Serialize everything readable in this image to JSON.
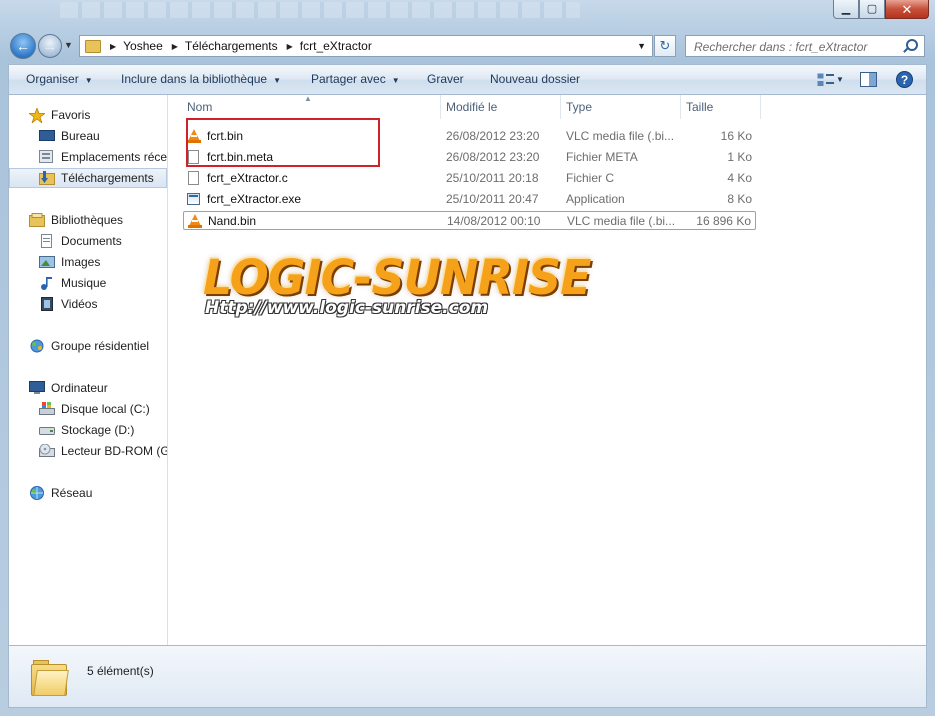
{
  "window": {
    "buttons": {
      "minimize": "▁",
      "maximize": "▢",
      "close": "✕"
    }
  },
  "address": {
    "crumbs": [
      "Yoshee",
      "Téléchargements",
      "fcrt_eXtractor"
    ],
    "search_placeholder": "Rechercher dans : fcrt_eXtractor"
  },
  "toolbar": {
    "organiser": "Organiser",
    "inclure": "Inclure dans la bibliothèque",
    "partager": "Partager avec",
    "graver": "Graver",
    "nouveau_dossier": "Nouveau dossier"
  },
  "nav": {
    "favoris": "Favoris",
    "bureau": "Bureau",
    "emplacements": "Emplacements récents",
    "telechargements": "Téléchargements",
    "bibliotheques": "Bibliothèques",
    "documents": "Documents",
    "images": "Images",
    "musique": "Musique",
    "videos": "Vidéos",
    "groupe": "Groupe résidentiel",
    "ordinateur": "Ordinateur",
    "disque_c": "Disque local (C:)",
    "stockage_d": "Stockage (D:)",
    "lecteur_bd": "Lecteur BD-ROM (G:",
    "reseau": "Réseau"
  },
  "columns": {
    "name": "Nom",
    "modified": "Modifié le",
    "type": "Type",
    "size": "Taille"
  },
  "files": [
    {
      "name": "fcrt.bin",
      "modified": "26/08/2012 23:20",
      "type": "VLC media file (.bi...",
      "size": "16 Ko",
      "icon": "vlc-icon"
    },
    {
      "name": "fcrt.bin.meta",
      "modified": "26/08/2012 23:20",
      "type": "Fichier META",
      "size": "1 Ko",
      "icon": "document-icon"
    },
    {
      "name": "fcrt_eXtractor.c",
      "modified": "25/10/2011 20:18",
      "type": "Fichier C",
      "size": "4 Ko",
      "icon": "document-icon"
    },
    {
      "name": "fcrt_eXtractor.exe",
      "modified": "25/10/2011 20:47",
      "type": "Application",
      "size": "8 Ko",
      "icon": "application-icon"
    },
    {
      "name": "Nand.bin",
      "modified": "14/08/2012 00:10",
      "type": "VLC media file (.bi...",
      "size": "16 896 Ko",
      "icon": "vlc-icon"
    }
  ],
  "watermark": {
    "title": "LOGIC-SUNRISE",
    "url": "Http://www.logic-sunrise.com"
  },
  "status": {
    "count": "5 élément(s)"
  },
  "colors": {
    "highlight_box": "#d0212b",
    "accent": "#2f79c9"
  }
}
